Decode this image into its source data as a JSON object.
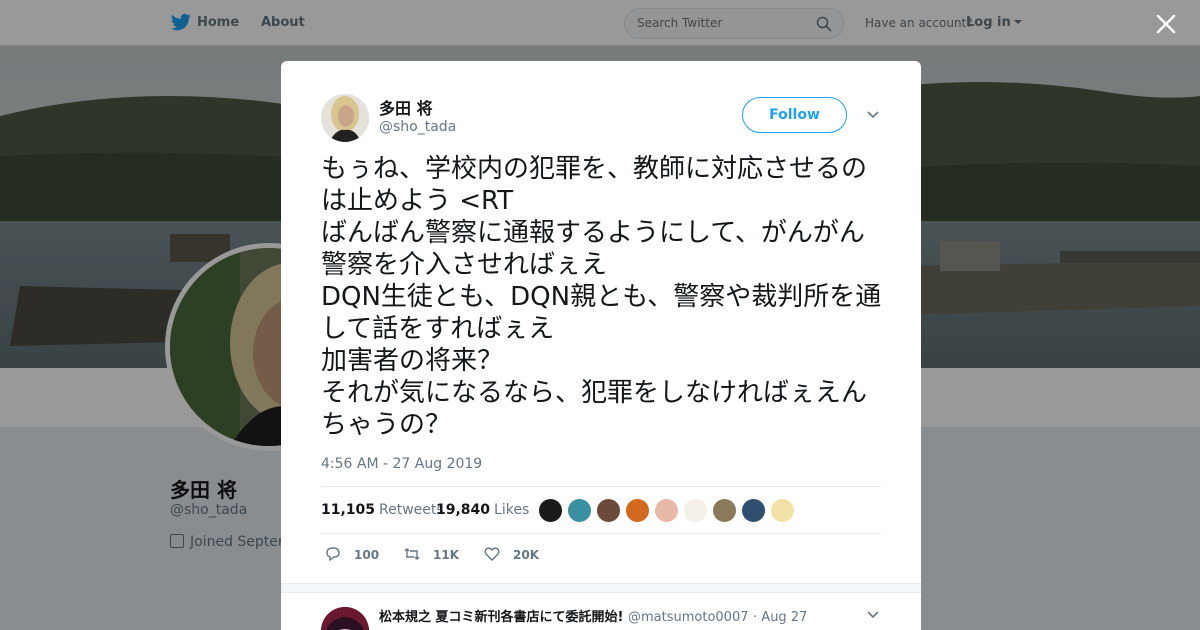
{
  "nav": {
    "home": "Home",
    "about": "About",
    "search_placeholder": "Search Twitter",
    "have_account": "Have an account?",
    "login": "Log in"
  },
  "background_profile": {
    "name": "多田 将",
    "handle": "@sho_tada",
    "joined": "Joined Septem"
  },
  "tweet": {
    "author_name": "多田 将",
    "author_handle": "@sho_tada",
    "follow_label": "Follow",
    "text": "もぅね、学校内の犯罪を、教師に対応させるのは止めよう <RT\nばんばん警察に通報するようにして、がんがん警察を介入させればぇえ\nDQN生徒とも、DQN親とも、警察や裁判所を通して話をすればぇえ\n加害者の将来？\nそれが気になるなら、犯罪をしなければぇえんちゃうの？",
    "timestamp": "4:56 AM - 27 Aug 2019",
    "retweets_count": "11,105",
    "retweets_label": "Retweets",
    "likes_count": "19,840",
    "likes_label": "Likes",
    "actions": {
      "reply": "100",
      "retweet": "11K",
      "like": "20K"
    }
  },
  "reply_preview": {
    "name": "松本規之 夏コミ新刊各書店にて委託開始!",
    "handle": "@matsumoto0007",
    "date": "· Aug 27"
  },
  "colors": {
    "accent": "#1da1f2",
    "text": "#14171a",
    "muted": "#657786"
  },
  "icons": [
    "twitter-bird-icon",
    "search-icon",
    "close-icon",
    "chevron-down-icon",
    "reply-icon",
    "retweet-icon",
    "heart-icon",
    "calendar-icon"
  ]
}
